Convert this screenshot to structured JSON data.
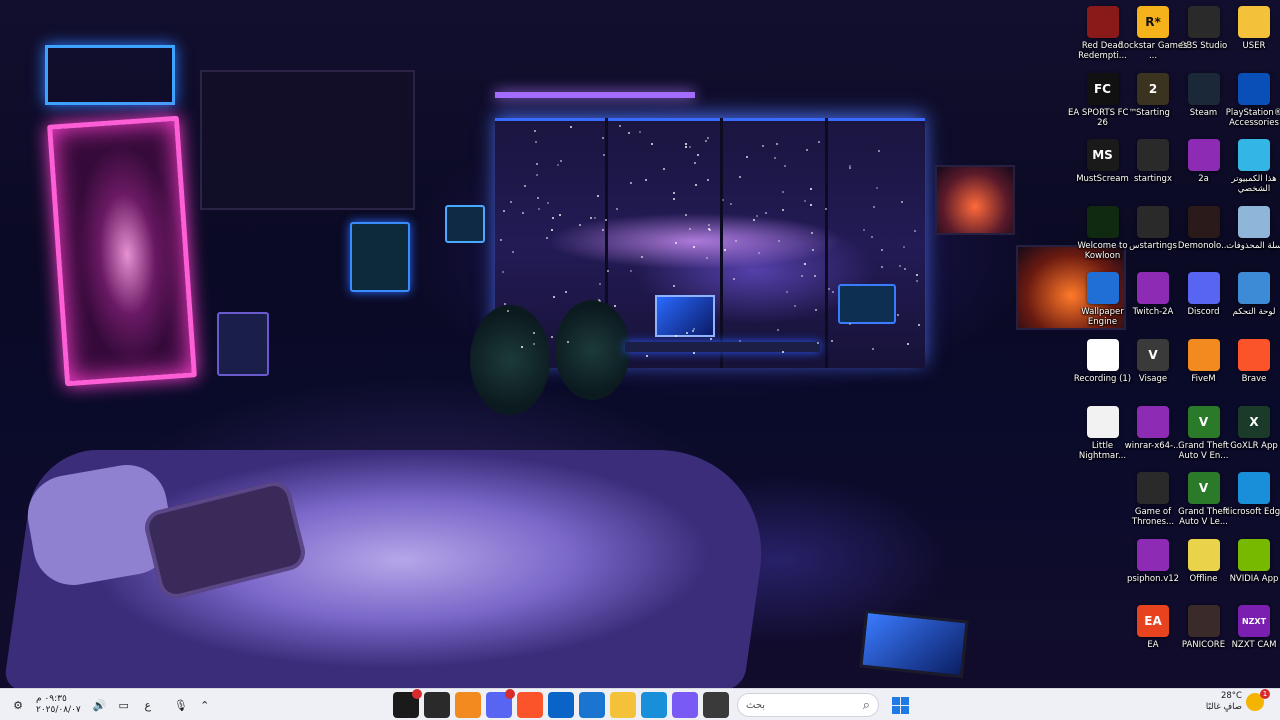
{
  "desktop_icons": [
    {
      "label": "USER",
      "icon": "folder-icon",
      "color": "#f3c13a",
      "col": 0,
      "row": 0
    },
    {
      "label": "OBS Studio",
      "icon": "obs-icon",
      "color": "#2a2a2a",
      "col": 1,
      "row": 0
    },
    {
      "label": "Rockstar Games ...",
      "icon": "rockstar-icon",
      "color": "#f6b21a",
      "col": 2,
      "row": 0,
      "glyph": "R*"
    },
    {
      "label": "Red Dead Redempti...",
      "icon": "red-dead-icon",
      "color": "#8a1a1a",
      "col": 3,
      "row": 0
    },
    {
      "label": "PlayStation® Accessories",
      "icon": "playstation-icon",
      "color": "#0a4fb7",
      "col": 0,
      "row": 1
    },
    {
      "label": "Steam",
      "icon": "steam-icon",
      "color": "#1b2838",
      "col": 1,
      "row": 1
    },
    {
      "label": "Starting",
      "icon": "starting-icon",
      "color": "#3a3320",
      "col": 2,
      "row": 1,
      "glyph": "2"
    },
    {
      "label": "EA SPORTS FC™ 26",
      "icon": "ea-fc-icon",
      "color": "#111111",
      "col": 3,
      "row": 1,
      "glyph": "FC"
    },
    {
      "label": "هذا الكمبيوتر الشخصي",
      "icon": "this-pc-icon",
      "color": "#33b5e5",
      "col": 0,
      "row": 2
    },
    {
      "label": "2a",
      "icon": "winrar-archive-icon",
      "color": "#8e2bb5",
      "col": 1,
      "row": 2
    },
    {
      "label": "startingx",
      "icon": "video-file-icon",
      "color": "#2a2a2a",
      "col": 2,
      "row": 2
    },
    {
      "label": "MustScream",
      "icon": "mustscream-icon",
      "color": "#1a1a1a",
      "col": 3,
      "row": 2,
      "glyph": "MS"
    },
    {
      "label": "سلة المحذوفات",
      "icon": "recycle-bin-icon",
      "color": "#8fb6d8",
      "col": 0,
      "row": 3
    },
    {
      "label": "Demonolo...",
      "icon": "demonologist-icon",
      "color": "#2a1a1a",
      "col": 1,
      "row": 3
    },
    {
      "label": "سstartings",
      "icon": "video-file-icon",
      "color": "#2a2a2a",
      "col": 2,
      "row": 3
    },
    {
      "label": "Welcome to Kowloon",
      "icon": "kowloon-icon",
      "color": "#0f2a10",
      "col": 3,
      "row": 3
    },
    {
      "label": "لوحة التحكم",
      "icon": "control-panel-icon",
      "color": "#3d8bd6",
      "col": 0,
      "row": 4
    },
    {
      "label": "Discord",
      "icon": "discord-icon",
      "color": "#5865f2",
      "col": 1,
      "row": 4
    },
    {
      "label": "Twitch-2A",
      "icon": "winrar-archive-icon",
      "color": "#8e2bb5",
      "col": 2,
      "row": 4
    },
    {
      "label": "Wallpaper Engine",
      "icon": "wallpaper-engine-icon",
      "color": "#1f6fd6",
      "col": 3,
      "row": 4
    },
    {
      "label": "Brave",
      "icon": "brave-icon",
      "color": "#fb542b",
      "col": 0,
      "row": 5
    },
    {
      "label": "FiveM",
      "icon": "fivem-icon",
      "color": "#f28a1f",
      "col": 1,
      "row": 5
    },
    {
      "label": "Visage",
      "icon": "visage-icon",
      "color": "#3a3a3a",
      "col": 2,
      "row": 5,
      "glyph": "V"
    },
    {
      "label": "Recording (1)",
      "icon": "recording-icon",
      "color": "#ffffff",
      "col": 3,
      "row": 5
    },
    {
      "label": "GoXLR App",
      "icon": "goxlr-icon",
      "color": "#1a3a2a",
      "col": 0,
      "row": 6,
      "glyph": "X"
    },
    {
      "label": "Grand Theft Auto V En...",
      "icon": "gta-v-icon",
      "color": "#2a7a2a",
      "col": 1,
      "row": 6,
      "glyph": "V"
    },
    {
      "label": "winrar-x64-...",
      "icon": "winrar-archive-icon",
      "color": "#8e2bb5",
      "col": 2,
      "row": 6
    },
    {
      "label": "Little Nightmar...",
      "icon": "little-nightmares-icon",
      "color": "#f2f2f2",
      "col": 3,
      "row": 6
    },
    {
      "label": "Microsoft Edge",
      "icon": "edge-icon",
      "color": "#1a8fd9",
      "col": 0,
      "row": 7
    },
    {
      "label": "Grand Theft Auto V Le...",
      "icon": "gta-v-icon",
      "color": "#2a7a2a",
      "col": 1,
      "row": 7,
      "glyph": "V"
    },
    {
      "label": "Game of Thrones...",
      "icon": "game-of-thrones-icon",
      "color": "#2a2a2a",
      "col": 2,
      "row": 7
    },
    {
      "label": "NVIDIA App",
      "icon": "nvidia-icon",
      "color": "#76b900",
      "col": 0,
      "row": 8
    },
    {
      "label": "Offline",
      "icon": "offline-icon",
      "color": "#e8d34a",
      "col": 1,
      "row": 8
    },
    {
      "label": "psiphon.v12",
      "icon": "winrar-archive-icon",
      "color": "#8e2bb5",
      "col": 2,
      "row": 8
    },
    {
      "label": "NZXT CAM",
      "icon": "nzxt-icon",
      "color": "#7a1fb0",
      "col": 0,
      "row": 9,
      "glyph": "NZXT"
    },
    {
      "label": "PANICORE",
      "icon": "panicore-icon",
      "color": "#3a2a2a",
      "col": 1,
      "row": 9
    },
    {
      "label": "EA",
      "icon": "ea-icon",
      "color": "#e8431f",
      "col": 2,
      "row": 9,
      "glyph": "EA"
    }
  ],
  "taskbar": {
    "clock_time": "٠٩:٣٥ م",
    "clock_date": "٢٠٢٥/٠٨/٠٧",
    "lang_indicator": "ع",
    "search_placeholder": "بحث",
    "apps": [
      {
        "name": "xbox-icon",
        "color": "#1a1a1a"
      },
      {
        "name": "terminal-icon",
        "color": "#2a2a2a"
      },
      {
        "name": "fivem-icon",
        "color": "#f28a1f"
      },
      {
        "name": "discord-icon",
        "color": "#5865f2"
      },
      {
        "name": "brave-icon",
        "color": "#fb542b"
      },
      {
        "name": "outlook-icon",
        "color": "#0a64c8"
      },
      {
        "name": "store-icon",
        "color": "#1b75d0"
      },
      {
        "name": "file-explorer-icon",
        "color": "#f3c13a"
      },
      {
        "name": "edge-icon",
        "color": "#1a8fd9"
      },
      {
        "name": "copilot-icon",
        "color": "#7a5af5"
      },
      {
        "name": "app-icon",
        "color": "#3a3a3a"
      }
    ],
    "weather_temp": "28°C",
    "weather_desc": "صافٍ غالبًا",
    "notification_count": "1"
  }
}
